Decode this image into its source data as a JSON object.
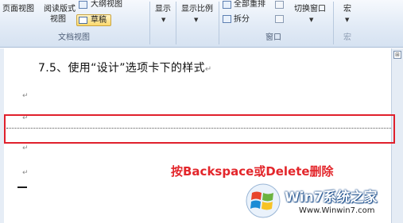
{
  "ribbon": {
    "view_group": {
      "page_view": "页面视图",
      "read_layout_line1": "阅读版式",
      "read_layout_line2": "视图",
      "outline": "大纲视图",
      "draft": "草稿",
      "label": "文档视图"
    },
    "show": "显示",
    "zoom": "显示比例",
    "window_group": {
      "arrange_all": "全部重排",
      "split": "拆分",
      "switch_windows": "切换窗口",
      "label": "窗口"
    },
    "macros": "宏",
    "macros_group_label": "宏"
  },
  "document": {
    "heading": "7.5、使用“设计”选项卡下的样式",
    "paragraph_mark": "↵",
    "line_mark": "↵"
  },
  "annotation": "按Backspace或Delete删除",
  "watermark": {
    "title": "Win7系统之家",
    "url": "Www.Winwin7.com"
  },
  "colors": {
    "highlight_border": "#e0202c",
    "annotation_text": "#e3262b",
    "ribbon_bg": "#dfe8f4",
    "draft_selected": "#fcd96d"
  }
}
